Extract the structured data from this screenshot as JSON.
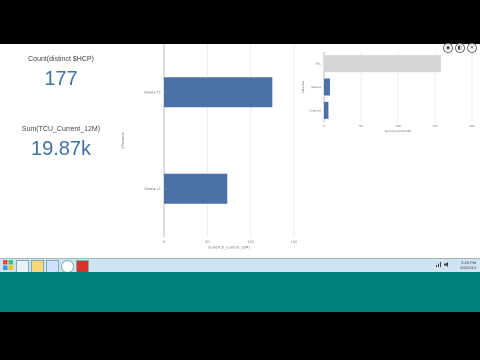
{
  "kpis": [
    {
      "title": "Count(distinct $HCP)",
      "value": "177"
    },
    {
      "title": "Sum(TCU_Current_12M)",
      "value": "19.87k"
    }
  ],
  "toolbar_icons": [
    "camera-icon",
    "restore-icon",
    "close-icon"
  ],
  "taskbar": {
    "apps": [
      "file-explorer-icon",
      "folder-icon",
      "mail-icon",
      "chrome-icon",
      "adobe-icon"
    ],
    "clock_time": "3:45 PM",
    "clock_date": "5/2/2014",
    "colors": {
      "taskbar": "#cfe3f3",
      "teal": "#00807a"
    }
  },
  "colors": {
    "bar": "#4a72a8",
    "kpi_value": "#3e6fa6",
    "highlight": "#d6d6d6"
  },
  "chart_data": [
    {
      "type": "bar",
      "orientation": "horizontal",
      "categories": [
        "Ghana T1",
        "Ghana L1"
      ],
      "values": [
        125,
        73
      ],
      "xlabel": "Sum(TCU_Current_12M)",
      "ylabel": "$Persona",
      "xlim": [
        0,
        150
      ],
      "xticks": [
        "0",
        "50",
        "100",
        "150"
      ],
      "grid": true
    },
    {
      "type": "bar",
      "orientation": "horizontal",
      "categories": [
        "ALL",
        "Ghana",
        "Ghana2"
      ],
      "values": [
        158,
        8,
        6
      ],
      "xlabel": "Sum(Current12M)",
      "ylabel": "$Market",
      "xlim": [
        0,
        200
      ],
      "xticks": [
        "0",
        "50",
        "100",
        "150",
        "200"
      ],
      "grid": true
    }
  ]
}
